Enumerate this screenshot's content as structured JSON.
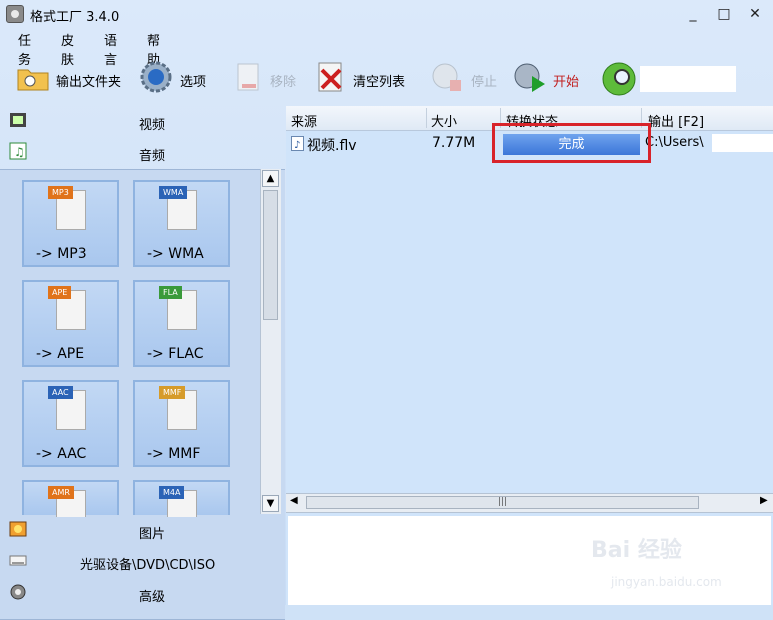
{
  "window": {
    "title": "格式工厂 3.4.0",
    "minimize": "_",
    "maximize": "□",
    "close": "✕"
  },
  "menu": {
    "items": [
      "任务",
      "皮肤",
      "语言",
      "帮助"
    ]
  },
  "toolbar": {
    "output_folder": "输出文件夹",
    "options": "选项",
    "remove": "移除",
    "clear_list": "清空列表",
    "stop": "停止",
    "start": "开始"
  },
  "sidebar": {
    "categories_top": [
      {
        "label": "视频",
        "icon": "video-icon"
      },
      {
        "label": "音频",
        "icon": "audio-icon"
      }
    ],
    "tiles": [
      {
        "label": "-> MP3",
        "badge": "MP3",
        "badge_color": "#e0731a"
      },
      {
        "label": "-> WMA",
        "badge": "WMA",
        "badge_color": "#2b63b6"
      },
      {
        "label": "-> APE",
        "badge": "APE",
        "badge_color": "#e0731a"
      },
      {
        "label": "-> FLAC",
        "badge": "FLA",
        "badge_color": "#3a9a3a"
      },
      {
        "label": "-> AAC",
        "badge": "AAC",
        "badge_color": "#2b63b6"
      },
      {
        "label": "-> MMF",
        "badge": "MMF",
        "badge_color": "#d69b2a"
      },
      {
        "label": "",
        "badge": "AMR",
        "badge_color": "#e0731a"
      },
      {
        "label": "",
        "badge": "M4A",
        "badge_color": "#2b63b6"
      }
    ],
    "categories_bottom": [
      {
        "label": "图片",
        "icon": "picture-icon"
      },
      {
        "label": "光驱设备\\DVD\\CD\\ISO",
        "icon": "disc-icon"
      },
      {
        "label": "高级",
        "icon": "advanced-icon"
      }
    ],
    "scroll_up": "▲",
    "scroll_down": "▼"
  },
  "task_list": {
    "columns": [
      "来源",
      "大小",
      "转换状态",
      "输出 [F2]"
    ],
    "rows": [
      {
        "source": "视频.flv",
        "size": "7.77M",
        "status": "完成",
        "output": "C:\\Users\\"
      }
    ],
    "scroll_left": "◀",
    "scroll_right": "▶",
    "thumb_grip": "|||"
  },
  "watermark": {
    "line1": "Bai 经验",
    "line2": "jingyan.baidu.com"
  }
}
